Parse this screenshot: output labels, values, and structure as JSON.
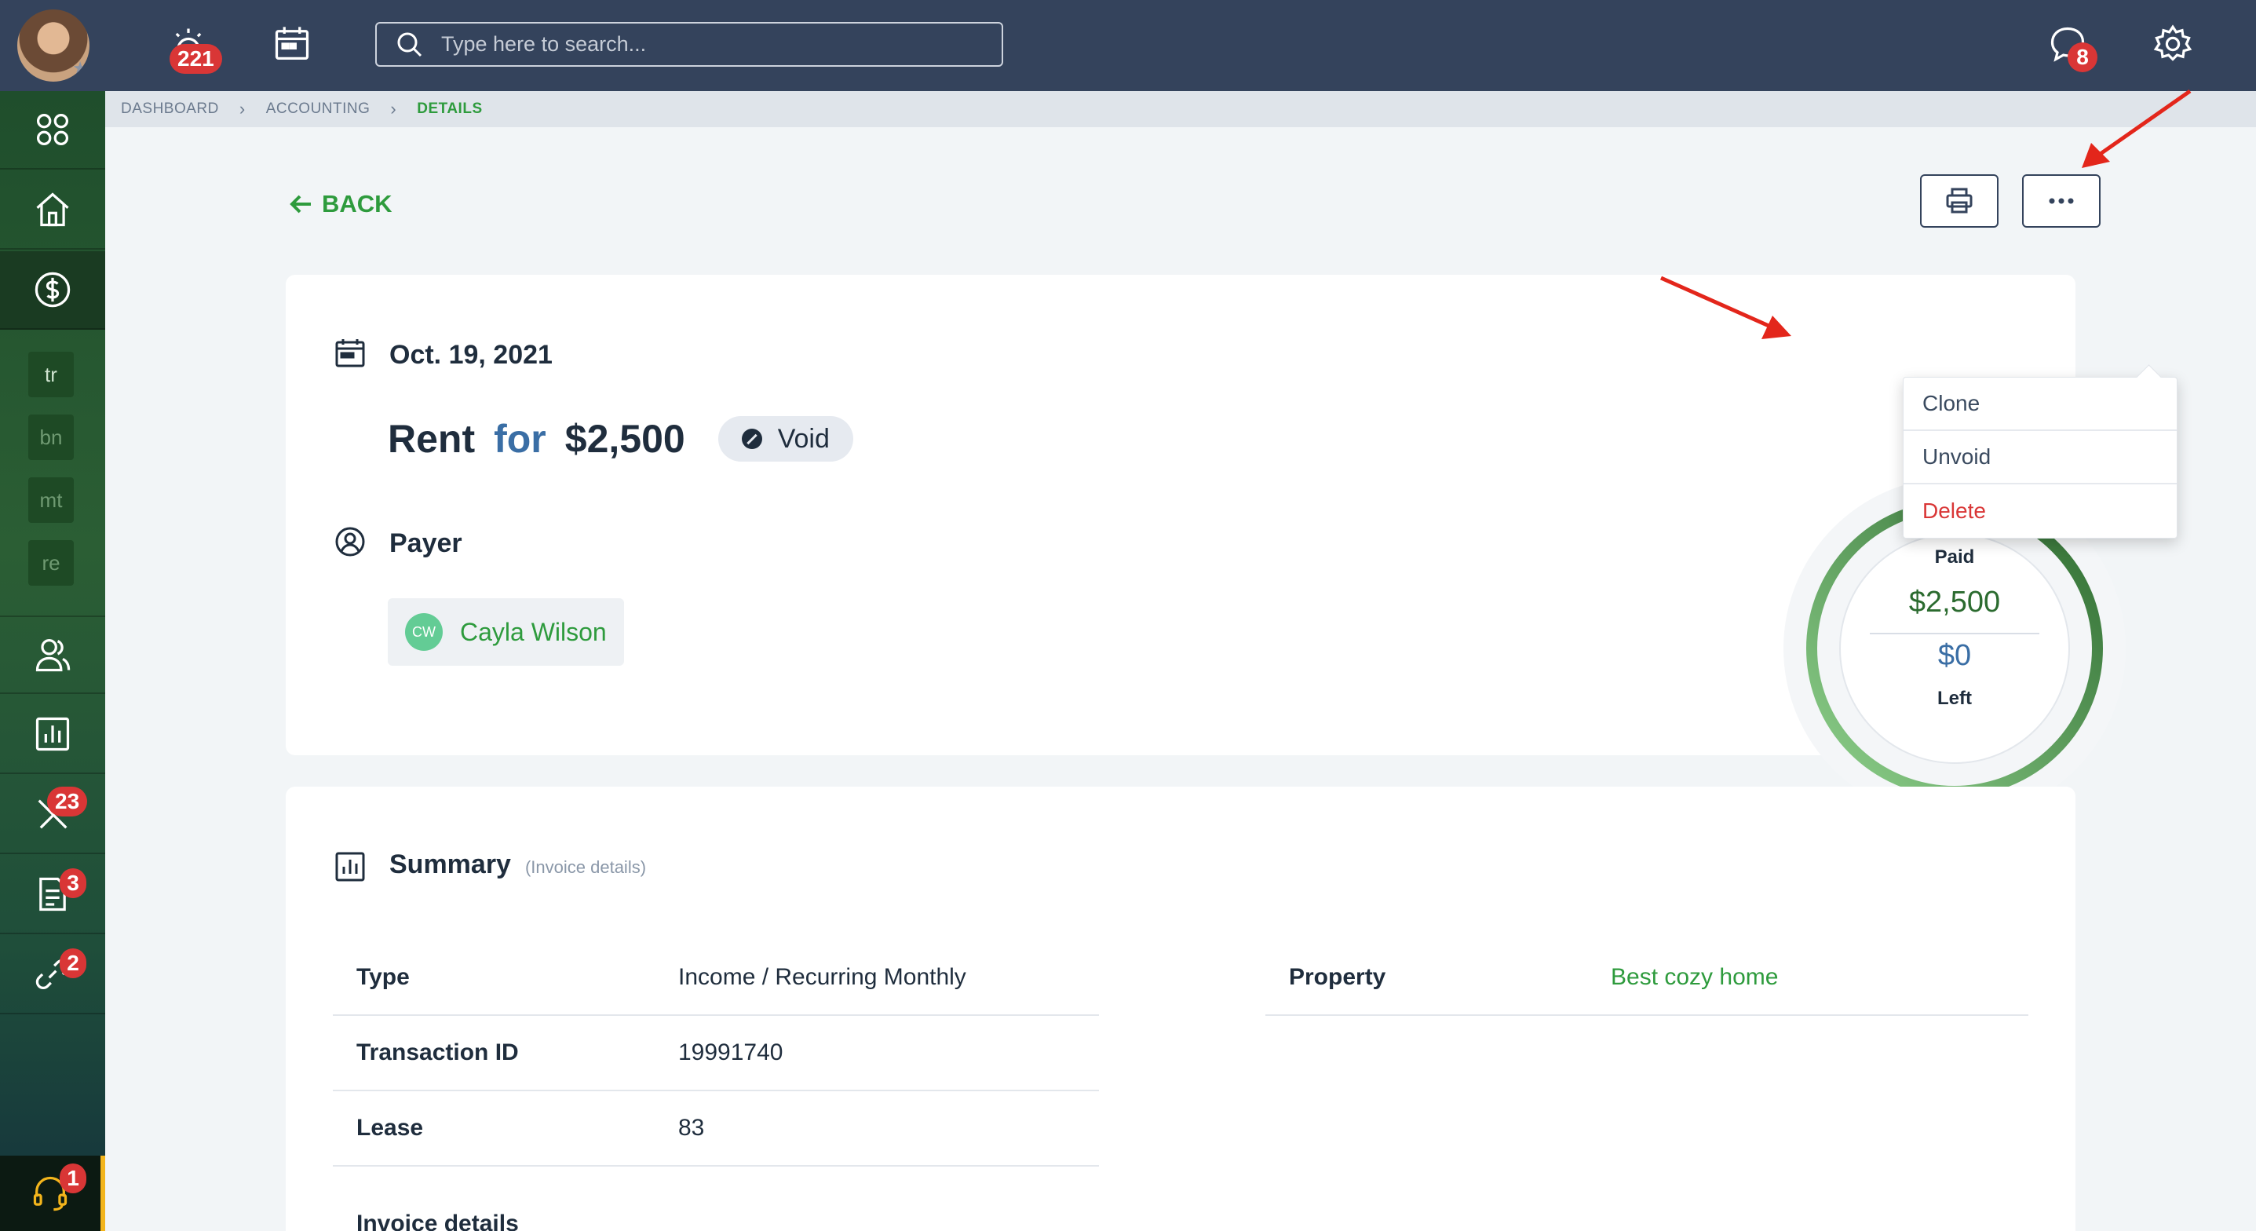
{
  "topbar": {
    "notifications_badge": "221",
    "messages_badge": "8",
    "search_placeholder": "Type here to search..."
  },
  "sidebar": {
    "chips": [
      "tr",
      "bn",
      "mt",
      "re"
    ],
    "tools_badge": "23",
    "documents_badge": "3",
    "links_badge": "2",
    "support_badge": "1"
  },
  "breadcrumb": [
    "DASHBOARD",
    "ACCOUNTING",
    "DETAILS"
  ],
  "back_label": "BACK",
  "transaction": {
    "date": "Oct. 19, 2021",
    "category": "Rent",
    "for_word": "for",
    "amount": "$2,500",
    "status": "Void",
    "payer_label": "Payer",
    "payer_initials": "CW",
    "payer_name": "Cayla Wilson"
  },
  "donut": {
    "paid_label": "Paid",
    "paid_amount": "$2,500",
    "left_amount": "$0",
    "left_label": "Left",
    "paid_fraction": 1.0
  },
  "menu": {
    "items": [
      "Clone",
      "Unvoid",
      "Delete"
    ]
  },
  "summary": {
    "title": "Summary",
    "subtitle": "(Invoice details)",
    "left_rows": [
      {
        "key": "Type",
        "value": "Income / Recurring Monthly"
      },
      {
        "key": "Transaction ID",
        "value": "19991740"
      },
      {
        "key": "Lease",
        "value": "83"
      }
    ],
    "right_rows": [
      {
        "key": "Property",
        "value": "Best cozy home"
      }
    ],
    "next_heading": "Invoice details"
  },
  "colors": {
    "topbar": "#34435c",
    "accent_green": "#2e9b3d",
    "badge_red": "#d93636",
    "link_blue": "#3a6ea5"
  }
}
